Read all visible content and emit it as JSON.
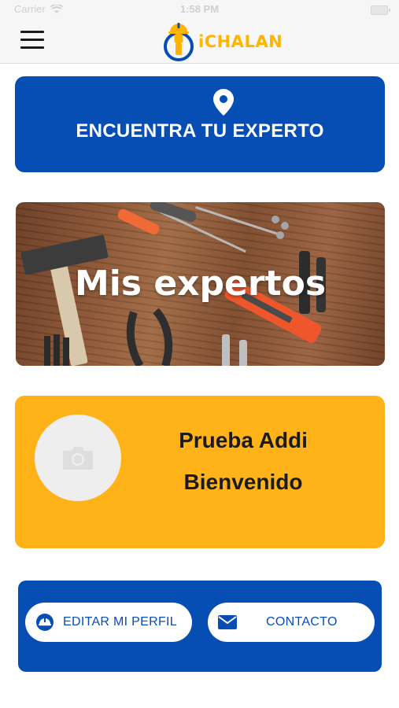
{
  "status_bar": {
    "carrier": "Carrier",
    "time": "1:58 PM"
  },
  "header": {
    "menu_icon": "hamburger-menu-icon",
    "logo_text": "iCHALAN",
    "logo_icon": "worker-helmet-logo"
  },
  "find_expert": {
    "label": "ENCUENTRA TU EXPERTO",
    "icon": "location-pin-icon"
  },
  "my_experts": {
    "title": "Mis expertos",
    "background": "tools-on-wood-image"
  },
  "profile": {
    "name": "Prueba Addi",
    "greeting": "Bienvenido",
    "avatar_icon": "camera-icon"
  },
  "actions": {
    "edit_profile_label": "EDITAR MI PERFIL",
    "edit_profile_icon": "helmet-icon",
    "contact_label": "CONTACTO",
    "contact_icon": "envelope-icon"
  },
  "colors": {
    "primary_blue": "#064eb4",
    "accent_yellow": "#ffb319",
    "logo_yellow": "#ffb400"
  }
}
